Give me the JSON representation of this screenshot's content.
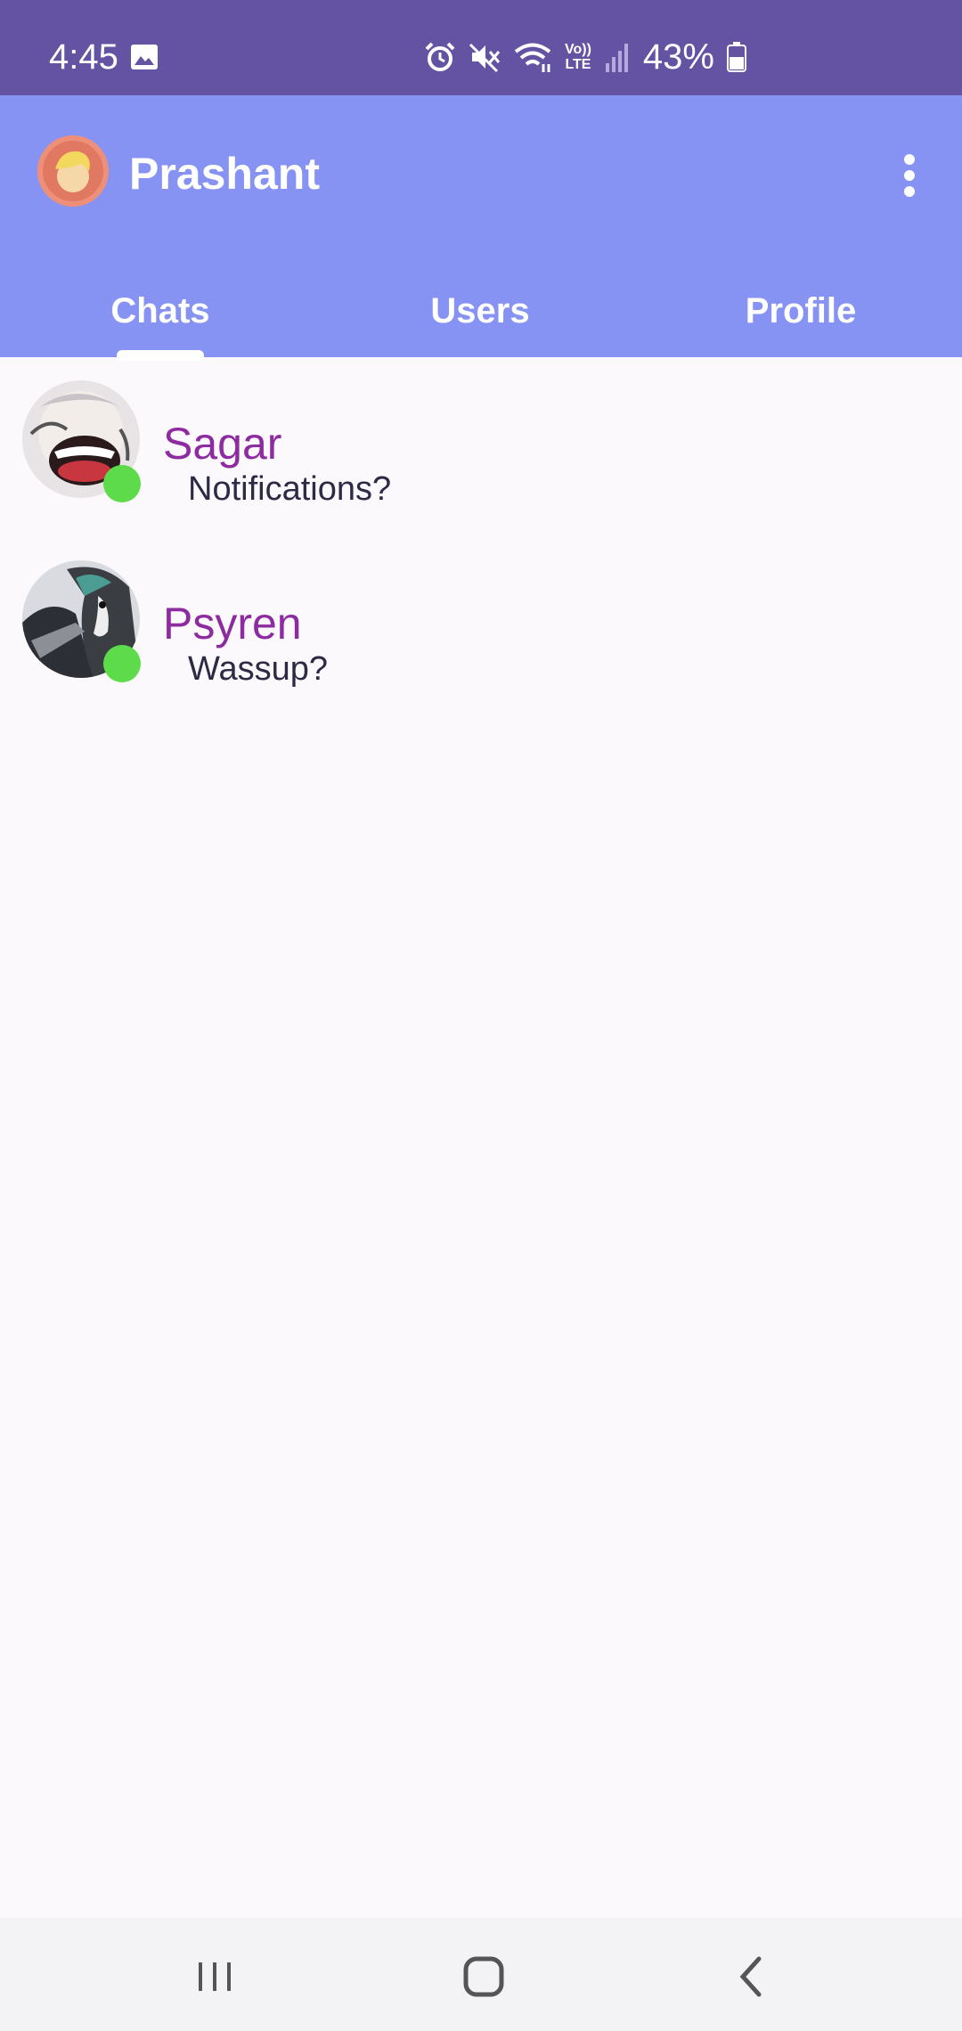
{
  "status_bar": {
    "time": "4:45",
    "battery_text": "43%",
    "icons": [
      "image-icon",
      "alarm-icon",
      "mute-icon",
      "wifi-icon",
      "volte-icon",
      "signal-icon",
      "battery-icon"
    ],
    "volte_label_top": "Vo))",
    "volte_label_bottom": "LTE"
  },
  "app_bar": {
    "title": "Prashant",
    "menu_icon": "more-vert-icon",
    "background": "#8793f2"
  },
  "tabs": [
    {
      "label": "Chats",
      "selected": true
    },
    {
      "label": "Users",
      "selected": false
    },
    {
      "label": "Profile",
      "selected": false
    }
  ],
  "chats": [
    {
      "name": "Sagar",
      "last_message": "Notifications?",
      "online": true
    },
    {
      "name": "Psyren",
      "last_message": "Wassup?",
      "online": true
    }
  ],
  "colors": {
    "status_bar": "#6353a2",
    "accent": "#8793f2",
    "name": "#8d2ba0",
    "online": "#5edb4a"
  },
  "nav_bar": {
    "icons": [
      "recents-icon",
      "home-icon",
      "back-icon"
    ]
  }
}
